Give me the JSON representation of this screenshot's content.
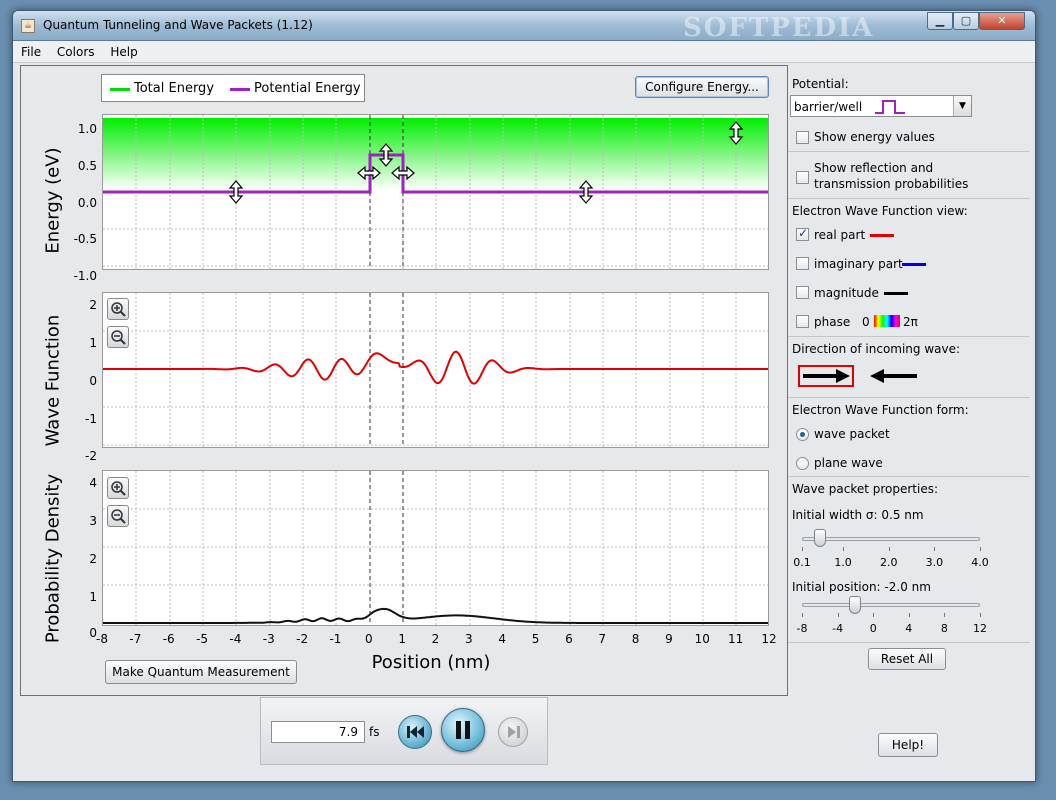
{
  "window": {
    "title": "Quantum Tunneling and Wave Packets (1.12)",
    "watermark": "SOFTPEDIA"
  },
  "menu": [
    "File",
    "Colors",
    "Help"
  ],
  "legend": {
    "total_energy": "Total Energy",
    "potential_energy": "Potential Energy",
    "total_color": "#00dd00",
    "potential_color": "#a020c0"
  },
  "buttons": {
    "configure_energy": "Configure Energy...",
    "measure": "Make Quantum Measurement",
    "reset_all": "Reset All",
    "help": "Help!"
  },
  "plots": {
    "energy_ylabel": "Energy (eV)",
    "wave_ylabel": "Wave Function",
    "prob_ylabel": "Probability Density",
    "xlabel": "Position (nm)",
    "energy_ticks": [
      "1.0",
      "0.5",
      "0.0",
      "-0.5",
      "-1.0"
    ],
    "wave_ticks": [
      "2",
      "1",
      "0",
      "-1",
      "-2"
    ],
    "prob_ticks": [
      "4",
      "3",
      "2",
      "1",
      "0"
    ],
    "x_ticks": [
      "-8",
      "-7",
      "-6",
      "-5",
      "-4",
      "-3",
      "-2",
      "-1",
      "0",
      "1",
      "2",
      "3",
      "4",
      "5",
      "6",
      "7",
      "8",
      "9",
      "10",
      "11",
      "12"
    ],
    "total_energy": 1.0,
    "barrier_start": 0,
    "barrier_end": 1,
    "barrier_height": 0.5
  },
  "controls": {
    "time_value": "7.9",
    "time_unit": "fs"
  },
  "side": {
    "potential_label": "Potential:",
    "potential_value": "barrier/well",
    "show_energy": "Show energy values",
    "show_reflection": "Show reflection and",
    "show_reflection2": "transmission probabilities",
    "wf_view_label": "Electron Wave Function view:",
    "real_part": "real part",
    "imag_part": "imaginary part",
    "magnitude": "magnitude",
    "phase": "phase",
    "phase_min": "0",
    "phase_max": "2π",
    "direction_label": "Direction of incoming wave:",
    "form_label": "Electron Wave Function form:",
    "wave_packet": "wave packet",
    "plane_wave": "plane wave",
    "packet_props": "Wave packet properties:",
    "width_label": "Initial width σ: 0.5 nm",
    "width_ticks": [
      "0.1",
      "1.0",
      "2.0",
      "3.0",
      "4.0"
    ],
    "width_value": 0.5,
    "position_label": "Initial position: -2.0 nm",
    "position_ticks": [
      "-8",
      "-4",
      "0",
      "4",
      "8",
      "12"
    ],
    "position_value": -2.0,
    "real_color": "#e00000",
    "imag_color": "#0000e0",
    "mag_color": "#000000"
  }
}
